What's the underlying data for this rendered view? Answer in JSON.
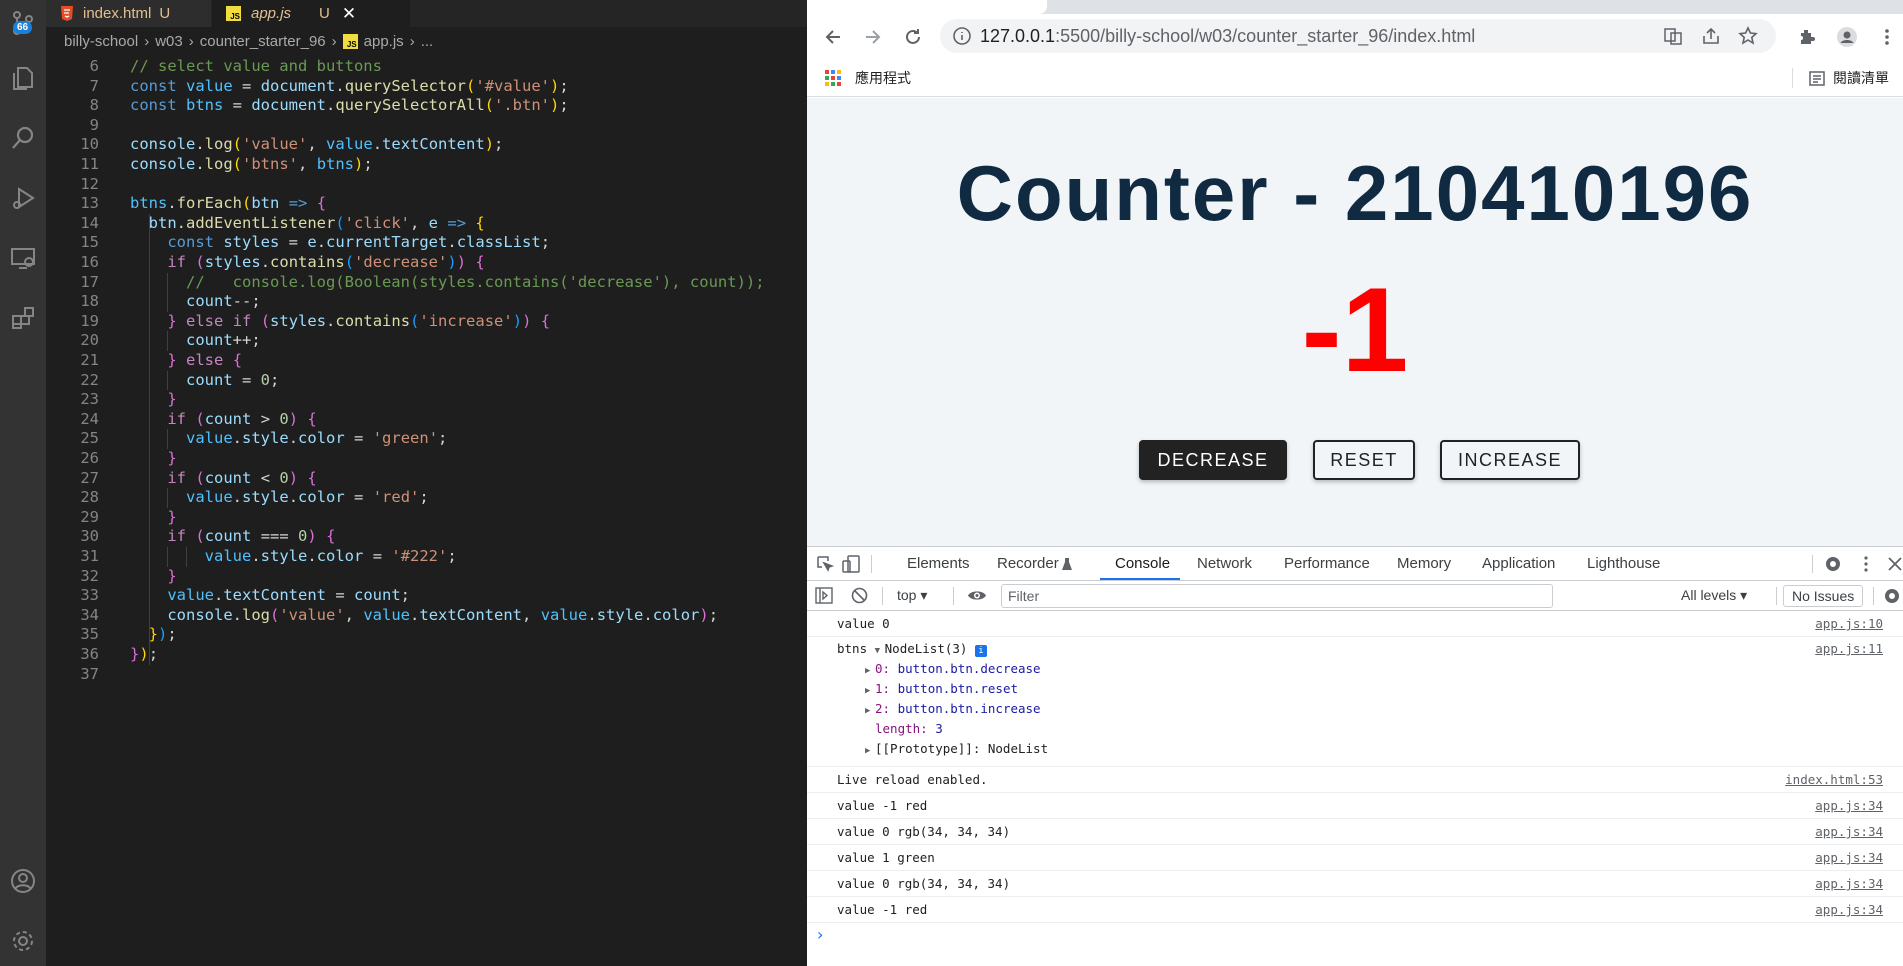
{
  "vscode": {
    "tabs": [
      {
        "name": "index.html",
        "status": "U"
      },
      {
        "name": "app.js",
        "status": "U"
      }
    ],
    "badge": "66",
    "breadcrumb": [
      "billy-school",
      "w03",
      "counter_starter_96",
      "app.js",
      "..."
    ],
    "code_lines": [
      {
        "num": "6"
      },
      {
        "num": "7"
      },
      {
        "num": "8"
      },
      {
        "num": "9"
      },
      {
        "num": "10"
      },
      {
        "num": "11"
      },
      {
        "num": "12"
      },
      {
        "num": "13"
      },
      {
        "num": "14"
      },
      {
        "num": "15"
      },
      {
        "num": "16"
      },
      {
        "num": "17"
      },
      {
        "num": "18"
      },
      {
        "num": "19"
      },
      {
        "num": "20"
      },
      {
        "num": "21"
      },
      {
        "num": "22"
      },
      {
        "num": "23"
      },
      {
        "num": "24"
      },
      {
        "num": "25"
      },
      {
        "num": "26"
      },
      {
        "num": "27"
      },
      {
        "num": "28"
      },
      {
        "num": "29"
      },
      {
        "num": "30"
      },
      {
        "num": "31"
      },
      {
        "num": "32"
      },
      {
        "num": "33"
      },
      {
        "num": "34"
      },
      {
        "num": "35"
      },
      {
        "num": "36"
      },
      {
        "num": "37"
      }
    ],
    "code_text": [
      "// select value and buttons",
      "const value = document.querySelector('#value');",
      "const btns = document.querySelectorAll('.btn');",
      "",
      "console.log('value', value.textContent);",
      "console.log('btns', btns);",
      "",
      "btns.forEach(btn => {",
      "  btn.addEventListener('click', e => {",
      "    const styles = e.currentTarget.classList;",
      "    if (styles.contains('decrease')) {",
      "      //   console.log(Boolean(styles.contains('decrease'), count));",
      "      count--;",
      "    } else if (styles.contains('increase')) {",
      "      count++;",
      "    } else {",
      "      count = 0;",
      "    }",
      "    if (count > 0) {",
      "      value.style.color = 'green';",
      "    }",
      "    if (count < 0) {",
      "      value.style.color = 'red';",
      "    }",
      "    if (count === 0) {",
      "        value.style.color = '#222';",
      "    }",
      "    value.textContent = count;",
      "    console.log('value', value.textContent, value.style.color);",
      "  });",
      "});",
      ""
    ]
  },
  "chrome": {
    "url_host": "127.0.0.1",
    "url_rest": ":5500/billy-school/w03/counter_starter_96/index.html",
    "bookmark_apps": "應用程式",
    "reading_list": "閱讀清單",
    "page": {
      "title": "Counter - 210410196",
      "value": "-1",
      "value_color": "#ff0000",
      "buttons": [
        "DECREASE",
        "RESET",
        "INCREASE"
      ]
    },
    "devtools": {
      "tabs": [
        "Elements",
        "Recorder",
        "Console",
        "Network",
        "Performance",
        "Memory",
        "Application",
        "Lighthouse"
      ],
      "active_tab": "Console",
      "context": "top",
      "filter_placeholder": "Filter",
      "levels": "All levels",
      "issues": "No Issues",
      "logs": [
        {
          "text": "value 0",
          "src": "app.js:10"
        },
        {
          "text": "btns",
          "nodelist": "NodeList(3)",
          "src": "app.js:11",
          "items": [
            {
              "key": "0:",
              "val": "button.btn.decrease"
            },
            {
              "key": "1:",
              "val": "button.btn.reset"
            },
            {
              "key": "2:",
              "val": "button.btn.increase"
            }
          ],
          "length_key": "length:",
          "length_val": "3",
          "proto": "[[Prototype]]: NodeList"
        },
        {
          "text": "Live reload enabled.",
          "src": "index.html:53"
        },
        {
          "text": "value -1 red",
          "src": "app.js:34"
        },
        {
          "text": "value 0 rgb(34, 34, 34)",
          "src": "app.js:34"
        },
        {
          "text": "value 1 green",
          "src": "app.js:34"
        },
        {
          "text": "value 0 rgb(34, 34, 34)",
          "src": "app.js:34"
        },
        {
          "text": "value -1 red",
          "src": "app.js:34"
        }
      ]
    }
  }
}
